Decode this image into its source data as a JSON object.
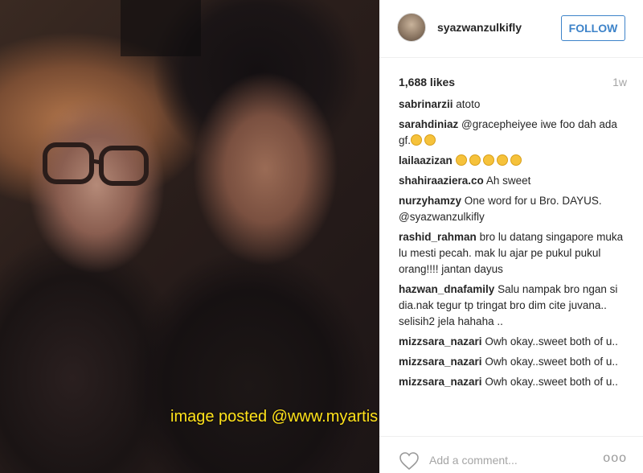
{
  "post": {
    "username": "syazwanzulkifly",
    "follow_label": "FOLLOW",
    "likes": "1,688 likes",
    "age": "1w",
    "comments": [
      {
        "user": "sabrinarzii",
        "text": "atoto",
        "emoji_count": 0
      },
      {
        "user": "sarahdiniaz",
        "text": "@gracepheiyee iwe foo dah ada gf.",
        "emoji_count": 2
      },
      {
        "user": "lailaazizan",
        "text": "",
        "emoji_count": 5
      },
      {
        "user": "shahiraaziera.co",
        "text": "Ah sweet",
        "emoji_count": 0
      },
      {
        "user": "nurzyhamzy",
        "text": "One word for u Bro. DAYUS. @syazwanzulkifly",
        "emoji_count": 0
      },
      {
        "user": "rashid_rahman",
        "text": "bro lu datang singapore muka lu mesti pecah. mak lu ajar pe pukul pukul orang!!!! jantan dayus",
        "emoji_count": 0
      },
      {
        "user": "hazwan_dnafamily",
        "text": "Salu nampak bro ngan si dia.nak tegur tp tringat bro dim cite juvana.. selisih2 jela hahaha ..",
        "emoji_count": 0
      },
      {
        "user": "mizzsara_nazari",
        "text": "Owh okay..sweet both of u..",
        "emoji_count": 0
      },
      {
        "user": "mizzsara_nazari",
        "text": "Owh okay..sweet both of u..",
        "emoji_count": 0
      },
      {
        "user": "mizzsara_nazari",
        "text": "Owh okay..sweet both of u..",
        "emoji_count": 0
      }
    ],
    "add_comment_placeholder": "Add a comment...",
    "more_label": "ooo"
  },
  "watermark": "image posted @www.myartis.com",
  "icons": {
    "avatar": "profile-avatar",
    "heart": "heart-icon",
    "more": "more-options-icon"
  },
  "colors": {
    "follow": "#3d83c9",
    "watermark": "#ffe21a"
  }
}
